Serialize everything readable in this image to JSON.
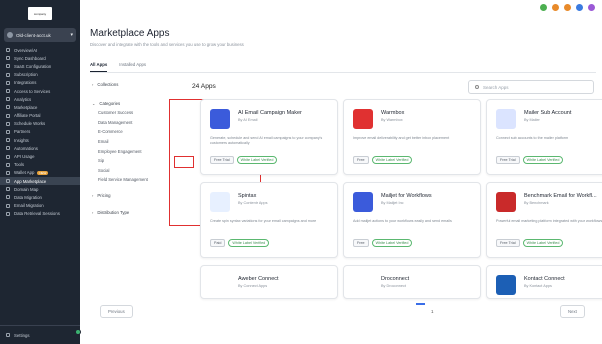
{
  "sidebar": {
    "logo_text": "company",
    "account": "Old-client-acct.uk",
    "items": [
      {
        "label": "Overview/AI",
        "active": false
      },
      {
        "label": "Sync Dashboard",
        "active": false
      },
      {
        "label": "SaaS Configuration",
        "active": false
      },
      {
        "label": "Subscription",
        "active": false
      },
      {
        "label": "Integrations",
        "active": false
      },
      {
        "label": "Access to Services",
        "active": false
      },
      {
        "label": "Analytics",
        "active": false
      },
      {
        "label": "Marketplace",
        "active": false
      },
      {
        "label": "Affiliate Portal",
        "active": false
      },
      {
        "label": "Schedule Works",
        "active": false
      },
      {
        "label": "Partners",
        "active": false
      },
      {
        "label": "Insights",
        "active": false
      },
      {
        "label": "Automations",
        "active": false
      },
      {
        "label": "API Usage",
        "active": false
      },
      {
        "label": "Tools",
        "active": false
      },
      {
        "label": "Wallet App",
        "active": false,
        "badge": "NEW"
      },
      {
        "label": "App Marketplace",
        "active": true
      },
      {
        "label": "Domain Map",
        "active": false
      },
      {
        "label": "Data Migration",
        "active": false
      },
      {
        "label": "Email Migration",
        "active": false
      },
      {
        "label": "Data Retrieval Sessions",
        "active": false
      }
    ],
    "bottom_label": "Settings"
  },
  "top_icons": [
    {
      "name": "google-icon",
      "color": "#4caf50"
    },
    {
      "name": "bell-icon",
      "color": "#e88a2a"
    },
    {
      "name": "help-icon",
      "color": "#e88a2a"
    },
    {
      "name": "status-icon",
      "color": "#3b7be0"
    },
    {
      "name": "avatar-icon",
      "color": "#9b59d6"
    }
  ],
  "page": {
    "title": "Marketplace Apps",
    "subtitle": "Discover and integrate with the tools and services you use to grow your business",
    "tabs": [
      "All Apps",
      "Installed Apps"
    ],
    "count": "24 Apps",
    "search_placeholder": "Search Apps"
  },
  "filters": {
    "collections": "Collections",
    "categories": "Categories",
    "category_items": [
      "Customer Success",
      "Data Management",
      "E-Commerce",
      "Email",
      "Employee Engagement",
      "Sip",
      "Social",
      "Field Service Management"
    ],
    "pricing": "Pricing",
    "distribution": "Distribution Type"
  },
  "apps": [
    {
      "name": "AI Email Campaign Maker",
      "by": "By AI Email",
      "desc": "Generate, schedule and send AI email campaigns to your company's customers automatically",
      "tags": [
        "Free Trial",
        "White Label Verified"
      ],
      "logo": "mail-app-icon",
      "logo_color": "#3b5bdb"
    },
    {
      "name": "Warmbox",
      "by": "By Warmbox",
      "desc": "Improve email deliverability and get better inbox placement",
      "tags": [
        "Free",
        "White Label Verified"
      ],
      "logo": "fire-icon",
      "logo_color": "#e03131"
    },
    {
      "name": "Mailer Sub Account",
      "by": "By Mailer",
      "desc": "Connect sub accounts to the mailer platform",
      "tags": [
        "Free Trial",
        "White Label Verified"
      ],
      "logo": "mailbox-icon",
      "logo_color": "#dbe4ff"
    },
    {
      "name": "Spintax",
      "by": "By Contentr Apps",
      "desc": "Create spin syntax variations for your email campaigns and more",
      "tags": [
        "Paid",
        "White Label Verified"
      ],
      "logo": "spintax-icon",
      "logo_color": "#e7f0ff"
    },
    {
      "name": "Mailjet for Workflows",
      "by": "By Mailjet Inc",
      "desc": "Add mailjet actions to your workflows easily and send emails",
      "tags": [
        "Free",
        "White Label Verified"
      ],
      "logo": "mailjet-icon",
      "logo_color": "#3b5bdb"
    },
    {
      "name": "Benchmark Email for Workfl...",
      "by": "By Benchmark",
      "desc": "Powerful email marketing platform integrated with your workflows",
      "tags": [
        "Free Trial",
        "White Label Verified"
      ],
      "logo": "benchmark-icon",
      "logo_color": "#c92a2a"
    },
    {
      "name": "Aweber Connect",
      "by": "By Connect Apps",
      "desc": "",
      "tags": [],
      "logo": "aweber-icon",
      "logo_color": "#ffffff"
    },
    {
      "name": "Droconnect",
      "by": "By Droconnect",
      "desc": "",
      "tags": [],
      "logo": "smile-icon",
      "logo_color": "#ffffff"
    },
    {
      "name": "Kontact Connect",
      "by": "By Kontact Apps",
      "desc": "",
      "tags": [],
      "logo": "k-icon",
      "logo_color": "#1c5fb5"
    }
  ],
  "pagination": {
    "prev": "Previous",
    "page": "1",
    "next": "Next"
  }
}
